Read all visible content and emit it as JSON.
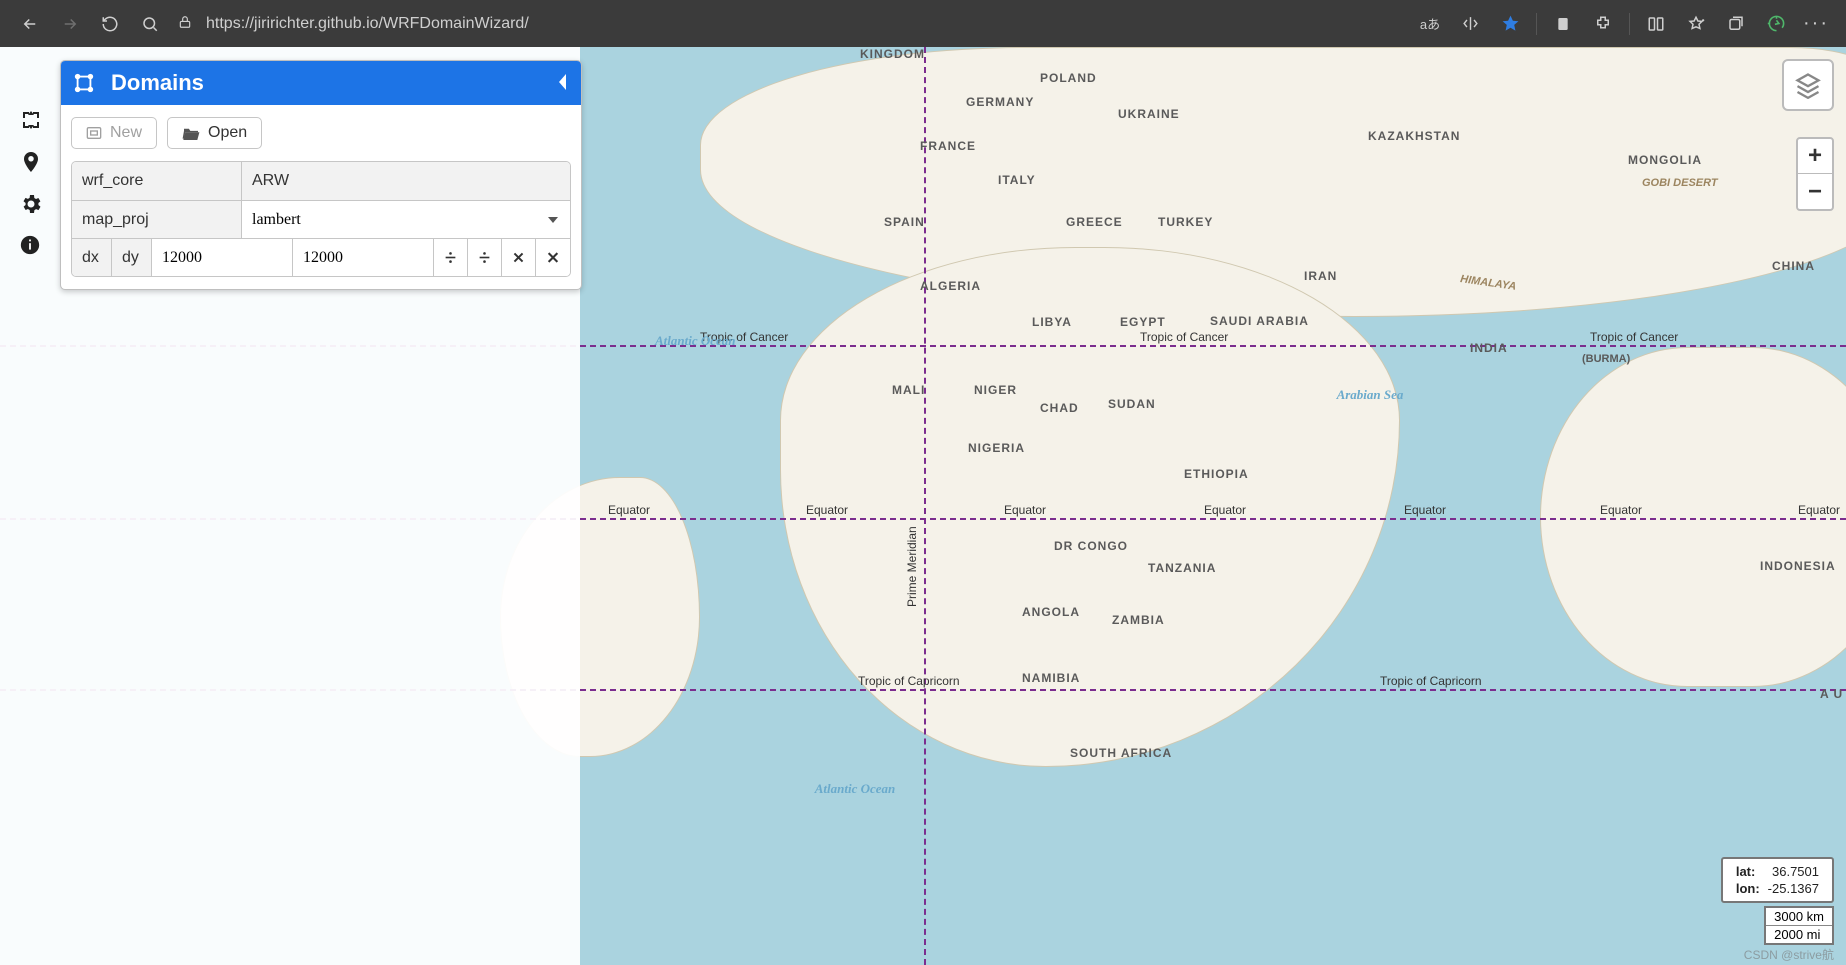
{
  "browser": {
    "url": "https://jiririchter.github.io/WRFDomainWizard/",
    "lang_badge": "aあ"
  },
  "panel": {
    "title": "Domains",
    "new_label": "New",
    "open_label": "Open",
    "wrf_core_label": "wrf_core",
    "wrf_core_value": "ARW",
    "map_proj_label": "map_proj",
    "map_proj_value": "lambert",
    "dx_label": "dx",
    "dy_label": "dy",
    "dx_value": "12000",
    "dy_value": "12000"
  },
  "map": {
    "tropic_cancer": "Tropic of Cancer",
    "equator": "Equator",
    "tropic_capricorn": "Tropic of Capricorn",
    "prime_meridian": "Prime Meridian",
    "zoom_in": "+",
    "zoom_out": "−",
    "countries": {
      "kingdom": "KINGDOM",
      "poland": "POLAND",
      "germany": "GERMANY",
      "france": "FRANCE",
      "ukraine": "UKRAINE",
      "kazakhstan": "KAZAKHSTAN",
      "mongolia": "MONGOLIA",
      "italy": "ITALY",
      "spain": "SPAIN",
      "greece": "GREECE",
      "turkey": "TURKEY",
      "algeria": "ALGERIA",
      "libya": "LIBYA",
      "egypt": "EGYPT",
      "saudi": "SAUDI ARABIA",
      "iran": "IRAN",
      "china": "CHINA",
      "india": "INDIA",
      "burma": "(BURMA)",
      "mali": "MALI",
      "niger": "NIGER",
      "chad": "CHAD",
      "sudan": "SUDAN",
      "nigeria": "NIGERIA",
      "ethiopia": "ETHIOPIA",
      "drcongo": "DR CONGO",
      "tanzania": "TANZANIA",
      "angola": "ANGOLA",
      "zambia": "ZAMBIA",
      "namibia": "NAMIBIA",
      "safrica": "SOUTH AFRICA",
      "indonesia": "INDONESIA",
      "au": "A U",
      "gobi": "GOBI DESERT",
      "himalaya": "HIMALAYA",
      "atlantic": "Atlantic Ocean",
      "arabian": "Arabian Sea",
      "atlantic2": "Atlantic Ocean"
    }
  },
  "coords": {
    "lat_label": "lat:",
    "lat_value": "36.7501",
    "lon_label": "lon:",
    "lon_value": "-25.1367"
  },
  "scale": {
    "km": "3000 km",
    "mi": "2000 mi"
  },
  "watermark": "CSDN @strive航"
}
